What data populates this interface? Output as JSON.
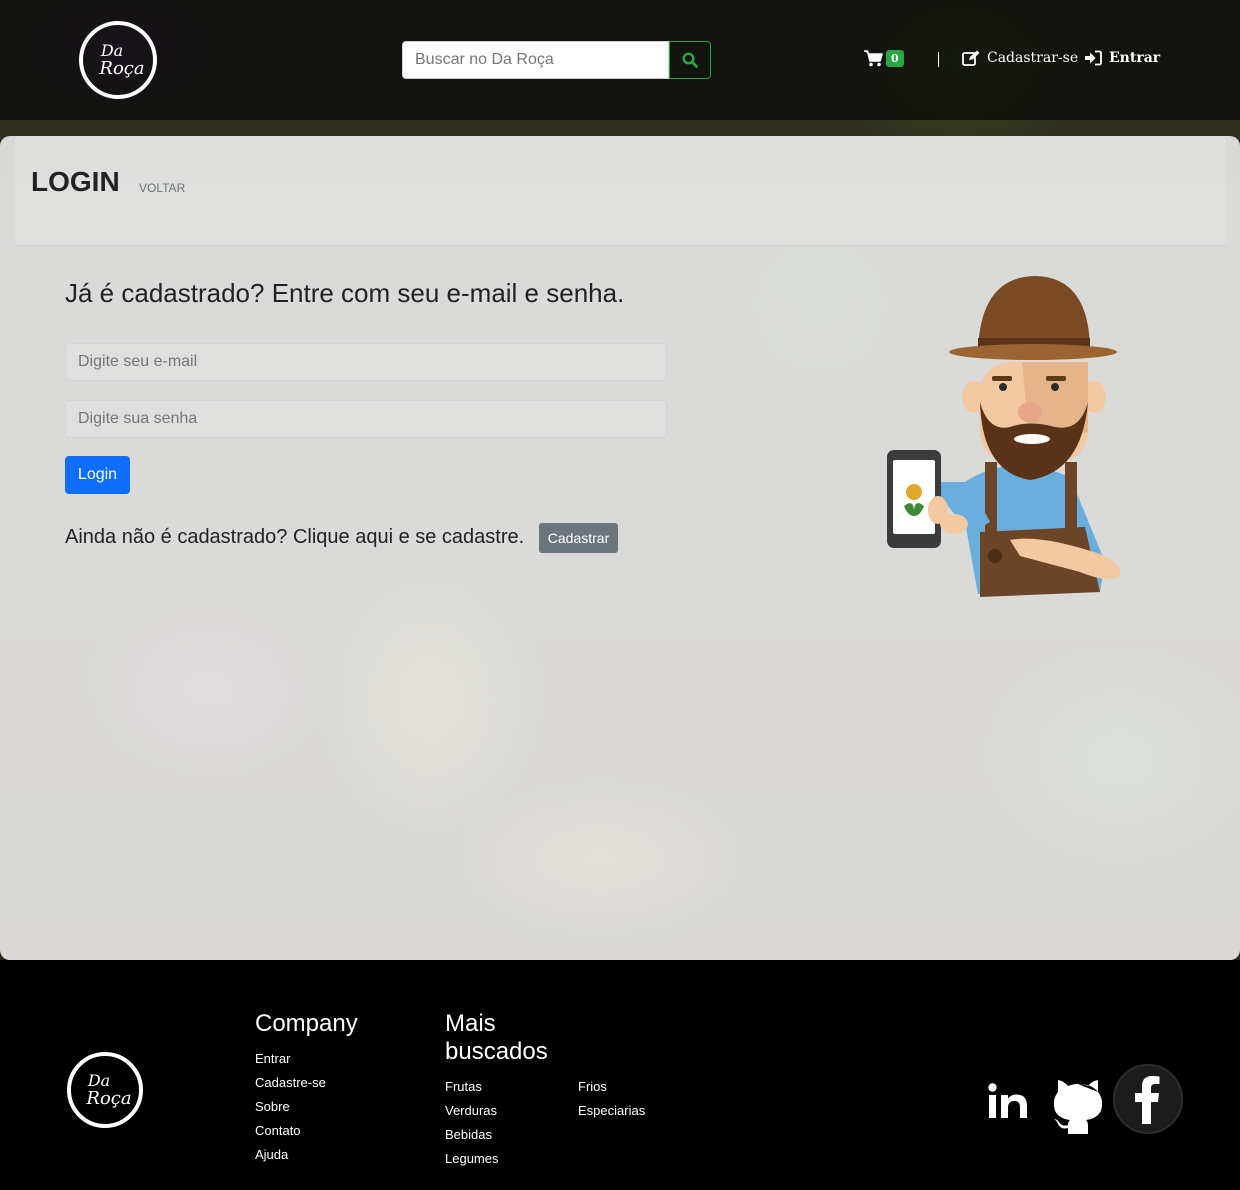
{
  "header": {
    "logo": {
      "line1": "Da",
      "line2": "Roça"
    },
    "search": {
      "placeholder": "Buscar no Da Roça"
    },
    "cart_count": "0",
    "signup_label": "Cadastrar-se",
    "login_label": "Entrar"
  },
  "main": {
    "title": "LOGIN",
    "back_label": "VOLTAR",
    "prompt": "Já é cadastrado? Entre com seu e-mail e senha.",
    "email_placeholder": "Digite seu e-mail",
    "password_placeholder": "Digite sua senha",
    "login_button": "Login",
    "signup_prompt": "Ainda não é cadastrado? Clique aqui e se cadastre.",
    "signup_button": "Cadastrar"
  },
  "footer": {
    "logo": {
      "line1": "Da",
      "line2": "Roça"
    },
    "company": {
      "title": "Company",
      "links": [
        "Entrar",
        "Cadastre-se",
        "Sobre",
        "Contato",
        "Ajuda"
      ]
    },
    "mais_buscados": {
      "title": "Mais buscados",
      "col1": [
        "Frutas",
        "Verduras",
        "Bebidas",
        "Legumes"
      ],
      "col2": [
        "Frios",
        "Especiarias"
      ]
    },
    "social_icons": [
      "linkedin-icon",
      "github-icon",
      "facebook-icon"
    ]
  },
  "colors": {
    "primary": "#0d6efd",
    "success": "#28a745",
    "secondary": "#6c757d"
  }
}
